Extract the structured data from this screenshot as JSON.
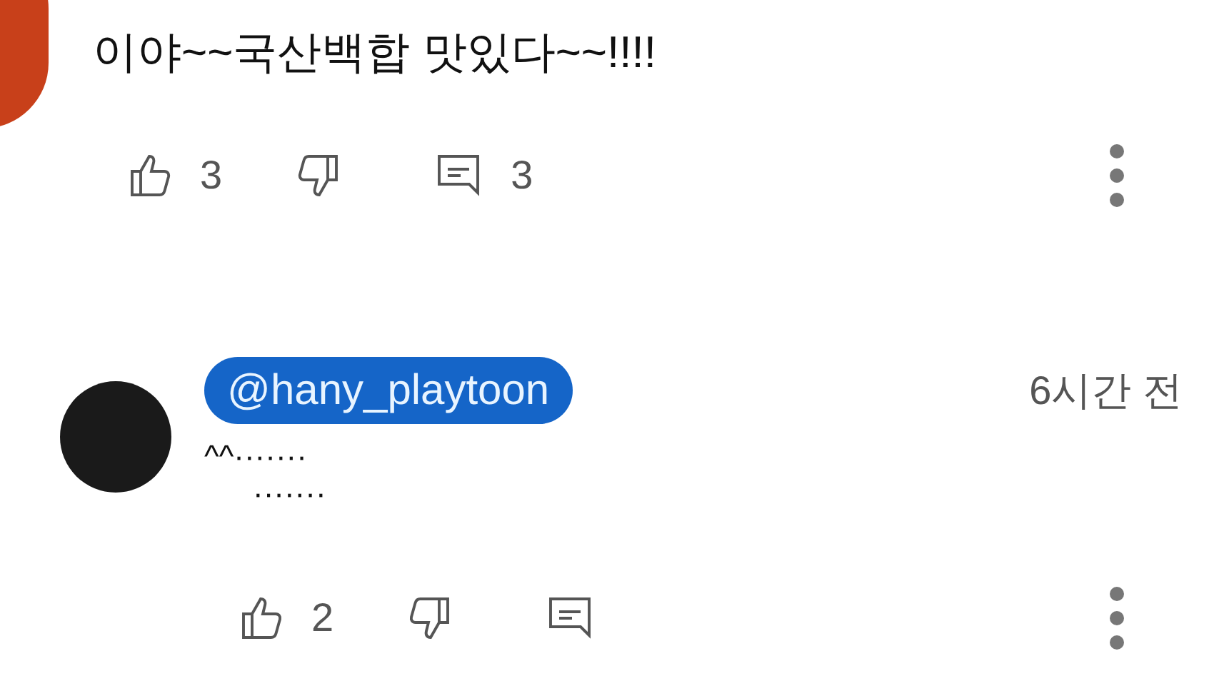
{
  "comments": [
    {
      "text": "이야~~국산백합 맛있다~~!!!!",
      "likes": "3",
      "replies": "3"
    },
    {
      "author": "@hany_playtoon",
      "time": "6시간 전",
      "lines": [
        "^^·······",
        "·······"
      ],
      "likes": "2"
    }
  ]
}
